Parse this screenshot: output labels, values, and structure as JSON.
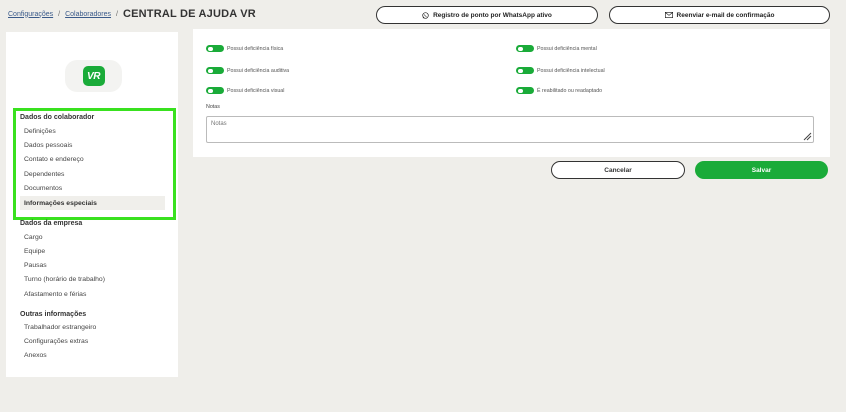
{
  "breadcrumb": {
    "items": [
      "Configurações",
      "Colaboradores"
    ],
    "separator": "/",
    "current": "CENTRAL DE AJUDA VR"
  },
  "header_buttons": {
    "whatsapp_label": "Registro de ponto por WhatsApp ativo",
    "resend_label": "Reenviar e-mail de confirmação"
  },
  "logo": {
    "text": "VR",
    "brand_color": "#1aab39"
  },
  "sidebar": {
    "sections": [
      {
        "title": "Dados do colaborador",
        "items": [
          "Definições",
          "Dados pessoais",
          "Contato e endereço",
          "Dependentes",
          "Documentos",
          "Informações especiais"
        ],
        "active_item": "Informações especiais"
      },
      {
        "title": "Dados da empresa",
        "items": [
          "Cargo",
          "Equipe",
          "Pausas",
          "Turno (horário de trabalho)",
          "Afastamento e férias"
        ]
      },
      {
        "title": "Outras informações",
        "items": [
          "Trabalhador estrangeiro",
          "Configurações extras",
          "Anexos"
        ]
      }
    ],
    "highlight_color": "#39e11f"
  },
  "special_info": {
    "toggles": [
      "Possui deficiência física",
      "Possui deficiência mental",
      "Possui deficiência auditiva",
      "Possui deficiência intelectual",
      "Possui deficiência visual",
      "É reabilitado ou readaptado"
    ],
    "notes_label": "Notas",
    "notes_placeholder": "Notas"
  },
  "actions": {
    "cancel_label": "Cancelar",
    "save_label": "Salvar"
  }
}
